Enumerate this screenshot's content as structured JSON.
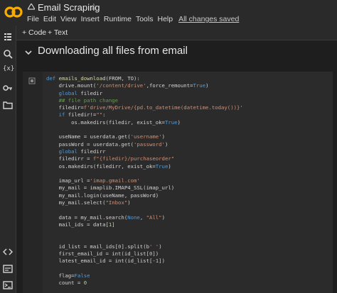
{
  "app": {
    "title": "Email Scraping",
    "menu": [
      "File",
      "Edit",
      "View",
      "Insert",
      "Runtime",
      "Tools",
      "Help"
    ],
    "saved_status": "All changes saved"
  },
  "toolbar": {
    "code_label": "+ Code",
    "text_label": "+ Text"
  },
  "sidebar": {
    "icons": [
      "menu-icon",
      "search-icon",
      "variables-icon",
      "key-icon",
      "folder-icon",
      "code-icon",
      "terminal-icon",
      "terminal-window-icon"
    ]
  },
  "section": {
    "title": "Downloading all files from email"
  },
  "code_lines": [
    "def emails_download(FROM, TO):",
    "    drive.mount('/content/drive',force_remount=True)",
    "    global filedir",
    "    ## file path change",
    "    filedir=f'drive/MyDrive/{pd.to_datetime(datetime.today())}'",
    "    if filedir!=\"\":",
    "        os.makedirs(filedir, exist_ok=True)",
    "",
    "    useName = userdata.get('username')",
    "    passWord = userdata.get('password')",
    "    global filedirr",
    "    filedirr = f\"{filedir}/purchaseorder\"",
    "    os.makedirs(filedirr, exist_ok=True)",
    "",
    "    imap_url ='imap.gmail.com'",
    "    my_mail = imaplib.IMAP4_SSL(imap_url)",
    "    my_mail.login(useName, passWord)",
    "    my_mail.select(\"Inbox\")",
    "",
    "    data = my_mail.search(None, \"All\")",
    "    mail_ids = data[1]",
    "",
    "",
    "    id_list = mail_ids[0].split(b' ')",
    "    first_email_id = int(id_list[0])",
    "    latest_email_id = int(id_list[-1])",
    "",
    "    flag=False",
    "    count = 0"
  ],
  "colors": {
    "background": "#1e1e1e",
    "cell_background": "#2b2b2b",
    "logo_orange": "#f9ab00"
  }
}
